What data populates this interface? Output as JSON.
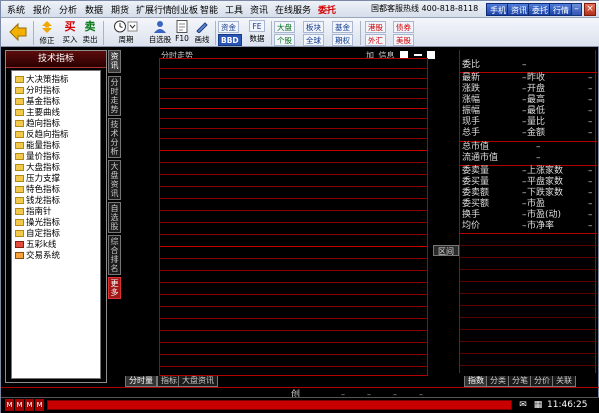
{
  "menu": {
    "items": [
      "系统",
      "报价",
      "分析",
      "数据",
      "期货",
      "扩展行情",
      "创业板",
      "智能",
      "工具",
      "资讯",
      "在线服务",
      "委托"
    ],
    "hotline": "国都客服热线 400-818-8118",
    "mode_buttons": [
      "手机",
      "资讯",
      "委托",
      "行情"
    ]
  },
  "toolbar": {
    "buttons": [
      {
        "label": "修正",
        "icon": "correct-icon"
      },
      {
        "label": "买入",
        "glyph": "买"
      },
      {
        "label": "卖出",
        "glyph": "卖"
      },
      {
        "label": "周期",
        "icon": "clock-icon"
      },
      {
        "label": "自选股",
        "icon": "person-icon"
      },
      {
        "label": "F10",
        "icon": "document-icon"
      },
      {
        "label": "画线",
        "icon": "pencil-icon"
      },
      {
        "label": "数据",
        "icon": "pie-icon"
      }
    ],
    "small_buttons": [
      "资金",
      "BBD",
      "大盘",
      "个股",
      "板块",
      "全球",
      "基金",
      "期权",
      "港股",
      "外汇",
      "债券",
      "美股"
    ],
    "f_button": "FE"
  },
  "left_panel": {
    "title": "技术指标",
    "items": [
      "大决策指标",
      "分时指标",
      "基金指标",
      "主要曲线",
      "趋向指标",
      "反趋向指标",
      "能量指标",
      "量价指标",
      "大盘指标",
      "压力支撑",
      "特色指标",
      "钱龙指标",
      "指南针",
      "操光指标",
      "自定指标",
      "五彩k线",
      "交易系统"
    ]
  },
  "vertical_tabs": [
    "资讯",
    "分时走势",
    "技术分析",
    "大盘资讯",
    "自选股",
    "综合排名",
    "更多"
  ],
  "chart": {
    "title": "分时走势",
    "controls": [
      "加",
      "信息"
    ],
    "volume_label": "区间"
  },
  "info_panel": {
    "rows_top": [
      {
        "k": "委比",
        "d": "–"
      },
      {
        "k": "最新",
        "d": "–",
        "k2": "昨收",
        "d2": "–"
      },
      {
        "k": "涨跌",
        "d": "–",
        "k2": "开盘",
        "d2": "–"
      },
      {
        "k": "涨幅",
        "d": "–",
        "k2": "最高",
        "d2": "–"
      },
      {
        "k": "振幅",
        "d": "–",
        "k2": "最低",
        "d2": "–"
      },
      {
        "k": "现手",
        "d": "–",
        "k2": "量比",
        "d2": "–"
      },
      {
        "k": "总手",
        "d": "–",
        "k2": "金额",
        "d2": "–"
      }
    ],
    "rows_mid": [
      {
        "k": "总市值",
        "d": "–"
      },
      {
        "k": "流通市值",
        "d": "–"
      }
    ],
    "rows_bottom": [
      {
        "k": "委卖量",
        "d": "–",
        "k2": "上涨家数",
        "d2": "–"
      },
      {
        "k": "委买量",
        "d": "–",
        "k2": "平盘家数",
        "d2": "–"
      },
      {
        "k": "委卖额",
        "d": "–",
        "k2": "下跌家数",
        "d2": "–"
      },
      {
        "k": "委买额",
        "d": "–",
        "k2": "市盈",
        "d2": "–"
      },
      {
        "k": "换手",
        "d": "–",
        "k2": "市盈(动)",
        "d2": "–"
      },
      {
        "k": "均价",
        "d": "–",
        "k2": "市净率",
        "d2": "–"
      }
    ]
  },
  "bottom_tabs": [
    "分时量",
    "指标",
    "大盘资讯"
  ],
  "right_tabs": [
    "指数",
    "分类",
    "分笔",
    "分价",
    "关联"
  ],
  "status": {
    "center_label": "创",
    "time": "11:46:25",
    "chips": [
      "M",
      "M",
      "M",
      "M"
    ]
  }
}
